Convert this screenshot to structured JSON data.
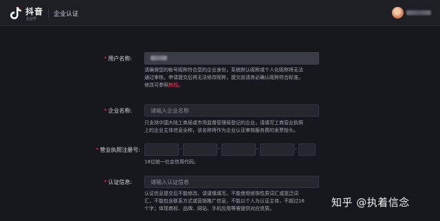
{
  "header": {
    "logo_title": "抖音",
    "logo_sub": "企业号",
    "page_title": "企业认证"
  },
  "form": {
    "username": {
      "label": "用户名称:",
      "hint_line1": "请确保您的帐号昵称符合您的企业身份，系统默认昵称或个人化昵称将无法",
      "hint_line2": "通过审核。申请提交后将无法修改昵称，提交前请务必确认昵称符合标准。",
      "hint_line3_prefix": "修改可参照",
      "hint_link": "教程",
      "hint_line3_suffix": "。"
    },
    "company": {
      "label": "企业名称:",
      "placeholder": "请输入企业名称",
      "hint_line1": "只支持中国大陆工商局或市场监督管理局登记的企业，请填写工商营业执照",
      "hint_line2": "上的企业主体信息全称，该名称将作为企业认证审核服务费的发票抬头。"
    },
    "license": {
      "label": "营业执照注册号:",
      "separator": "-",
      "hint": "18位统一社会信用代码。"
    },
    "cert": {
      "label": "认证信息:",
      "placeholder": "请输入认证信息",
      "hint_line1": "认证信息提交后不能修改，请谨慎填写。不能使用修饰性质词汇或宽泛词",
      "hint_line2": "汇，不能包含联系方式或营销推广信息，不能以个人为认证主体，不超过16",
      "hint_line3": "个字；体现商标、品牌、网站、手机应用等需提供对应资质。"
    },
    "required_mark": "*"
  },
  "watermark": "知乎 @执着信念",
  "colors": {
    "accent": "#fe2c55",
    "background": "#16181d"
  }
}
